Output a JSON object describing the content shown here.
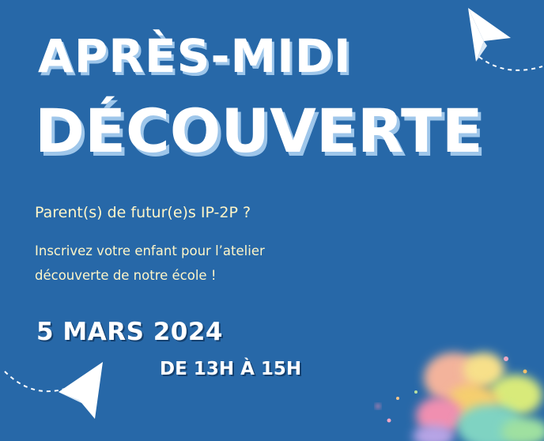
{
  "poster": {
    "title_line1": "APRÈS-MIDI",
    "title_line2": "DÉCOUVERTE",
    "question": "Parent(s) de futur(e)s IP-2P ?",
    "description_line1": "Inscrivez votre enfant pour l’atelier",
    "description_line2": "découverte de notre école !",
    "date": "5 MARS 2024",
    "time": "DE 13H À 15H"
  },
  "colors": {
    "background": "#2768a8",
    "title_shadow": "#9ec6ea",
    "subtitle_text": "#fff6c8",
    "text": "#ffffff"
  },
  "icons": {
    "top_right": "paper-plane-icon",
    "bottom_left": "paper-plane-icon",
    "bottom_right": "watercolor-splash"
  }
}
